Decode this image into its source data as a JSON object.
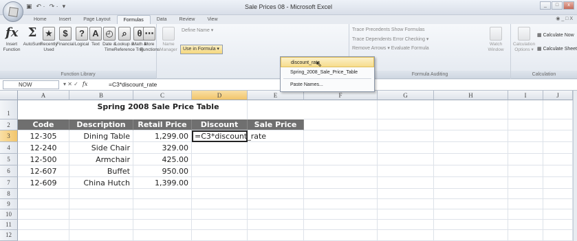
{
  "window": {
    "title": "Sale Prices 08 - Microsoft Excel"
  },
  "qat": {
    "save": "▣",
    "undo": "↶ ·",
    "redo": "↷ ·",
    "more": "▾"
  },
  "tabs": [
    "Home",
    "Insert",
    "Page Layout",
    "Formulas",
    "Data",
    "Review",
    "View"
  ],
  "ribbon_right": "◉ _ □ X",
  "ribbon": {
    "function_library": {
      "label": "Function Library",
      "buttons": [
        {
          "label": "Insert Function",
          "glyph": "fx"
        },
        {
          "label": "AutoSum",
          "glyph": "Σ"
        },
        {
          "label": "Recently Used",
          "glyph": "★"
        },
        {
          "label": "Financial",
          "glyph": "$"
        },
        {
          "label": "Logical",
          "glyph": "?"
        },
        {
          "label": "Text",
          "glyph": "A"
        },
        {
          "label": "Date & Time",
          "glyph": "◴"
        },
        {
          "label": "Lookup & Reference",
          "glyph": "⌕"
        },
        {
          "label": "Math & Trig",
          "glyph": "θ"
        },
        {
          "label": "More Functions",
          "glyph": "⋯"
        }
      ]
    },
    "defined_names": {
      "name_manager": "Name Manager",
      "define_name": "Define Name ▾",
      "use_in_formula": "Use in Formula ▾"
    },
    "formula_auditing": {
      "label": "Formula Auditing",
      "rows": [
        "Trace Precedents   Show Formulas",
        "Trace Dependents   Error Checking ▾",
        "Remove Arrows ▾   Evaluate Formula"
      ],
      "watch_window": "Watch Window"
    },
    "calculation": {
      "label": "Calculation",
      "options": "Calculation Options ▾",
      "calc_now": "Calculate Now",
      "calc_sheet": "Calculate Sheet"
    }
  },
  "dropdown": {
    "items": [
      "discount_rate",
      "Spring_2008_Sale_Price_Table"
    ],
    "paste_names": "Paste Names..."
  },
  "formula_bar": {
    "name_box": "NOW",
    "buttons": "▾  ✕ ✓",
    "fx": "fx",
    "formula": "=C3*discount_rate"
  },
  "columns": [
    "A",
    "B",
    "C",
    "D",
    "E",
    "F",
    "G",
    "H",
    "I",
    "J"
  ],
  "rows": [
    "1",
    "2",
    "3",
    "4",
    "5",
    "6",
    "7",
    "8",
    "9",
    "10",
    "11",
    "12"
  ],
  "sheet": {
    "title": "Spring 2008 Sale Price Table",
    "headers": [
      "Code",
      "Description",
      "Retail Price",
      "Discount",
      "Sale Price"
    ],
    "data": [
      [
        "12-305",
        "Dining Table",
        "1,299.00",
        "=C3*discount_rate",
        ""
      ],
      [
        "12-240",
        "Side Chair",
        "329.00",
        "",
        ""
      ],
      [
        "12-500",
        "Armchair",
        "425.00",
        "",
        ""
      ],
      [
        "12-607",
        "Buffet",
        "950.00",
        "",
        ""
      ],
      [
        "12-609",
        "China Hutch",
        "1,399.00",
        "",
        ""
      ]
    ]
  }
}
